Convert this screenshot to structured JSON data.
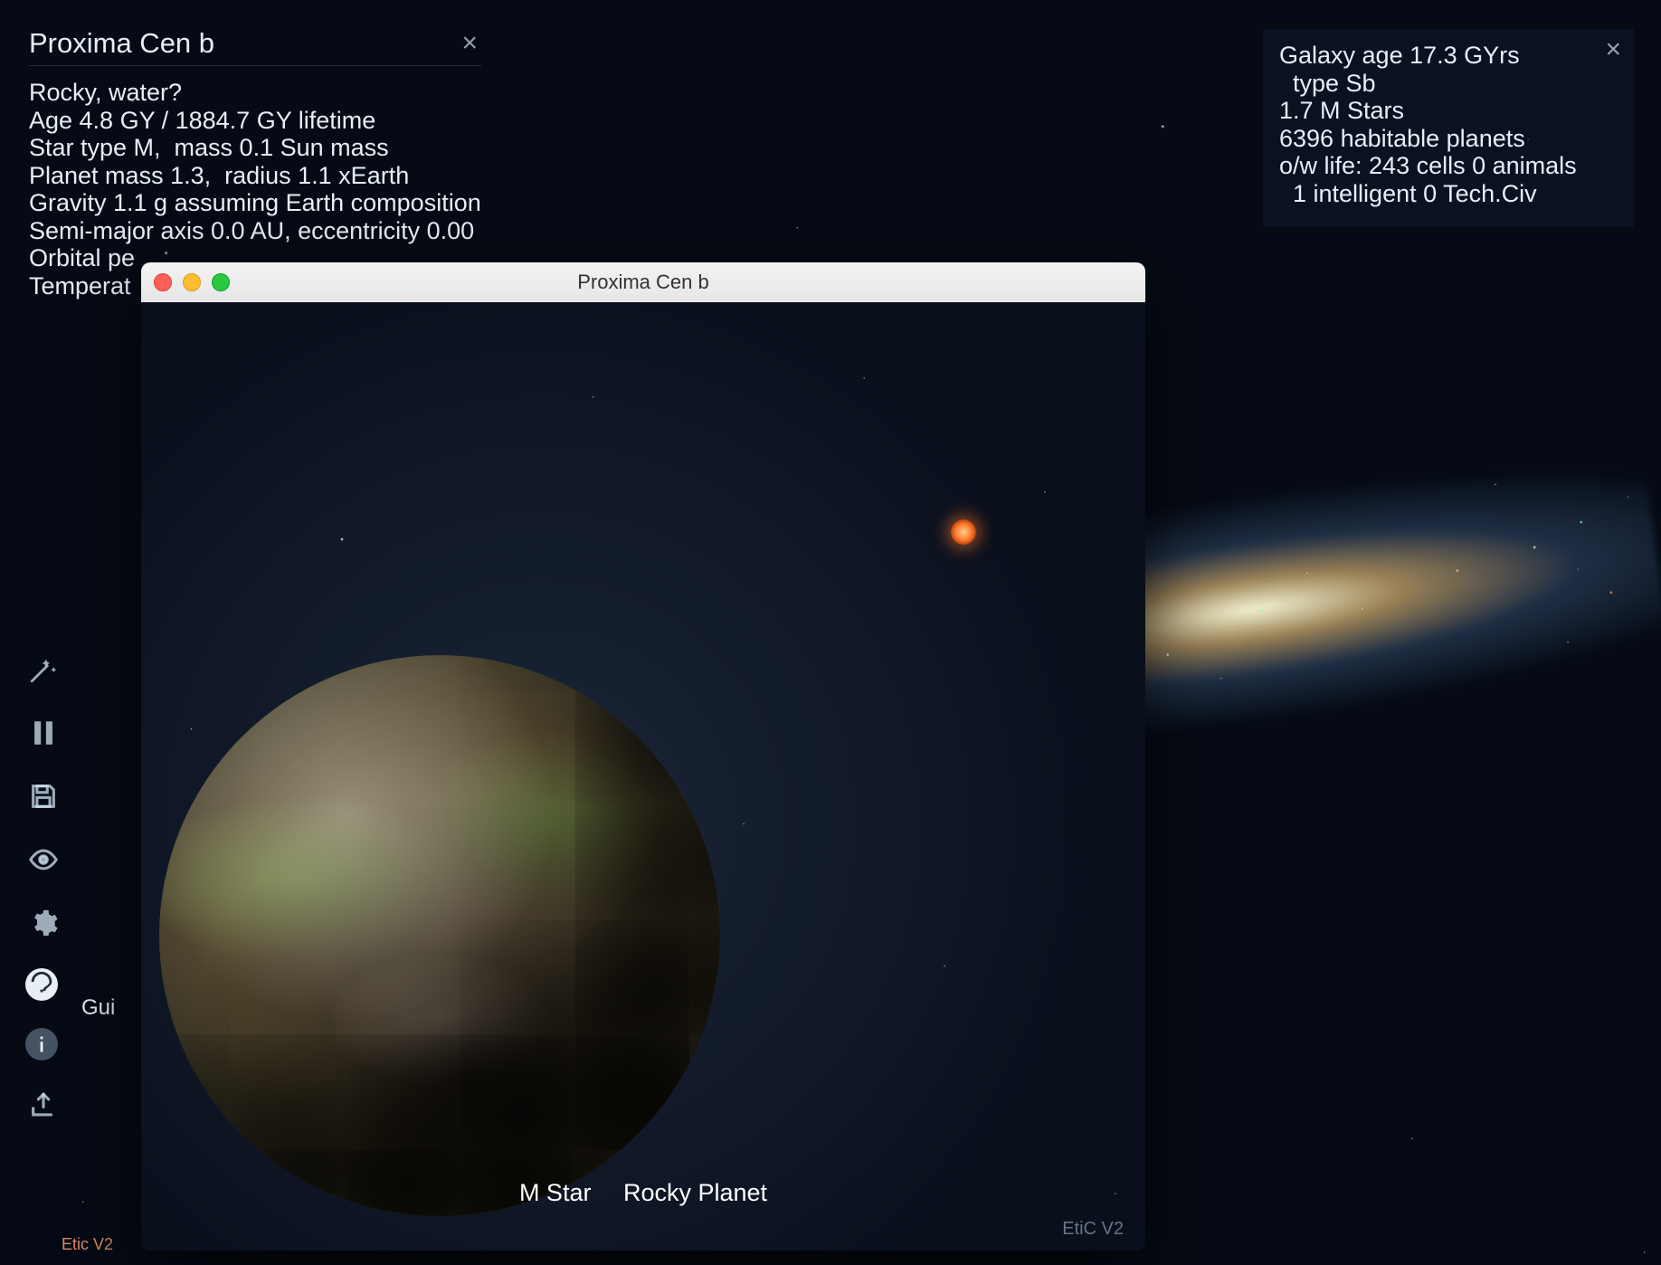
{
  "planet_panel": {
    "title": "Proxima Cen b",
    "lines": [
      "Rocky, water?",
      "Age 4.8 GY / 1884.7 GY lifetime",
      "Star type M,  mass 0.1 Sun mass",
      "Planet mass 1.3,  radius 1.1 xEarth",
      "Gravity 1.1 g assuming Earth composition",
      "Semi-major axis 0.0 AU, eccentricity 0.00",
      "Orbital pe",
      "Temperat"
    ]
  },
  "galaxy_panel": {
    "lines": [
      "Galaxy age 17.3 GYrs",
      "  type Sb",
      "1.7 M Stars",
      "6396 habitable planets",
      "o/w life: 243 cells 0 animals",
      "  1 intelligent 0 Tech.Civ"
    ]
  },
  "toolbar": {
    "tooltip_guide": "Gui",
    "items": [
      {
        "name": "magic-wand-icon"
      },
      {
        "name": "pause-icon"
      },
      {
        "name": "save-icon"
      },
      {
        "name": "eye-icon"
      },
      {
        "name": "gear-icon"
      },
      {
        "name": "help-icon"
      },
      {
        "name": "info-icon"
      },
      {
        "name": "share-icon"
      }
    ]
  },
  "version": "Etic V2",
  "detail_window": {
    "title": "Proxima Cen b",
    "star_label": "M Star",
    "planet_label": "Rocky Planet",
    "version": "EtiC V2"
  }
}
